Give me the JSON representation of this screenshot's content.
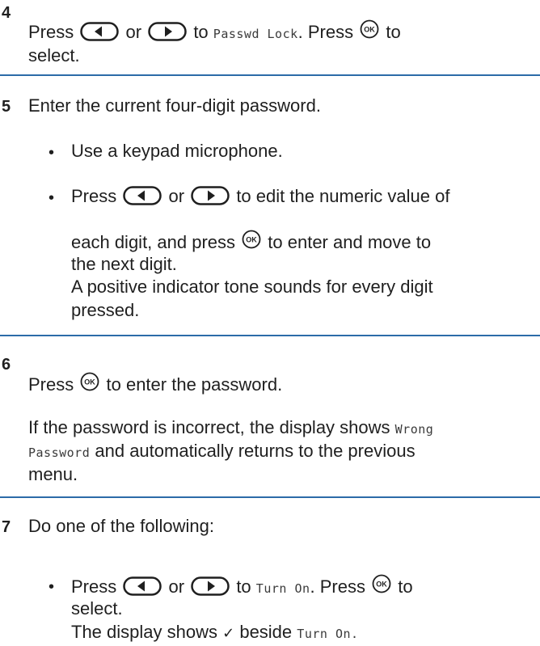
{
  "step4": {
    "number": "4",
    "line1_a": "Press",
    "line1_or": "or",
    "line1_to": "to",
    "line1_code": "Passwd Lock",
    "line1_b": ". Press",
    "line1_to2": "to",
    "line2": "select."
  },
  "step5": {
    "number": "5",
    "text": "Enter the current four-digit password.",
    "bullet1": "Use a keypad microphone.",
    "bullet2_a": "Press",
    "bullet2_or": "or",
    "bullet2_b": "to edit the numeric value of",
    "bullet2_c": "each digit, and press",
    "bullet2_d": "to enter and move to",
    "bullet2_e": "the next digit.",
    "bullet2_f": "A positive indicator tone sounds for every digit",
    "bullet2_g": "pressed."
  },
  "step6": {
    "number": "6",
    "line1_a": "Press",
    "line1_b": "to enter the password.",
    "line2_a": "If the password is incorrect, the display shows",
    "line2_code": "Wrong",
    "line3_code": "Password",
    "line3_b": "and automatically returns to the previous",
    "line4": "menu."
  },
  "step7": {
    "number": "7",
    "text": "Do one of the following:",
    "bullet_a": "Press",
    "bullet_or": "or",
    "bullet_to": "to",
    "bullet_code": "Turn On",
    "bullet_b": ". Press",
    "bullet_to2": "to",
    "bullet_c": "select.",
    "bullet_d": "The display shows",
    "bullet_check": "✓",
    "bullet_e": "beside",
    "bullet_code2": "Turn On."
  },
  "icons": {
    "left": "left-arrow-key-icon",
    "right": "right-arrow-key-icon",
    "ok": "ok-button-icon"
  },
  "colors": {
    "rule": "#2c6ba8",
    "text": "#1f1f1f"
  }
}
